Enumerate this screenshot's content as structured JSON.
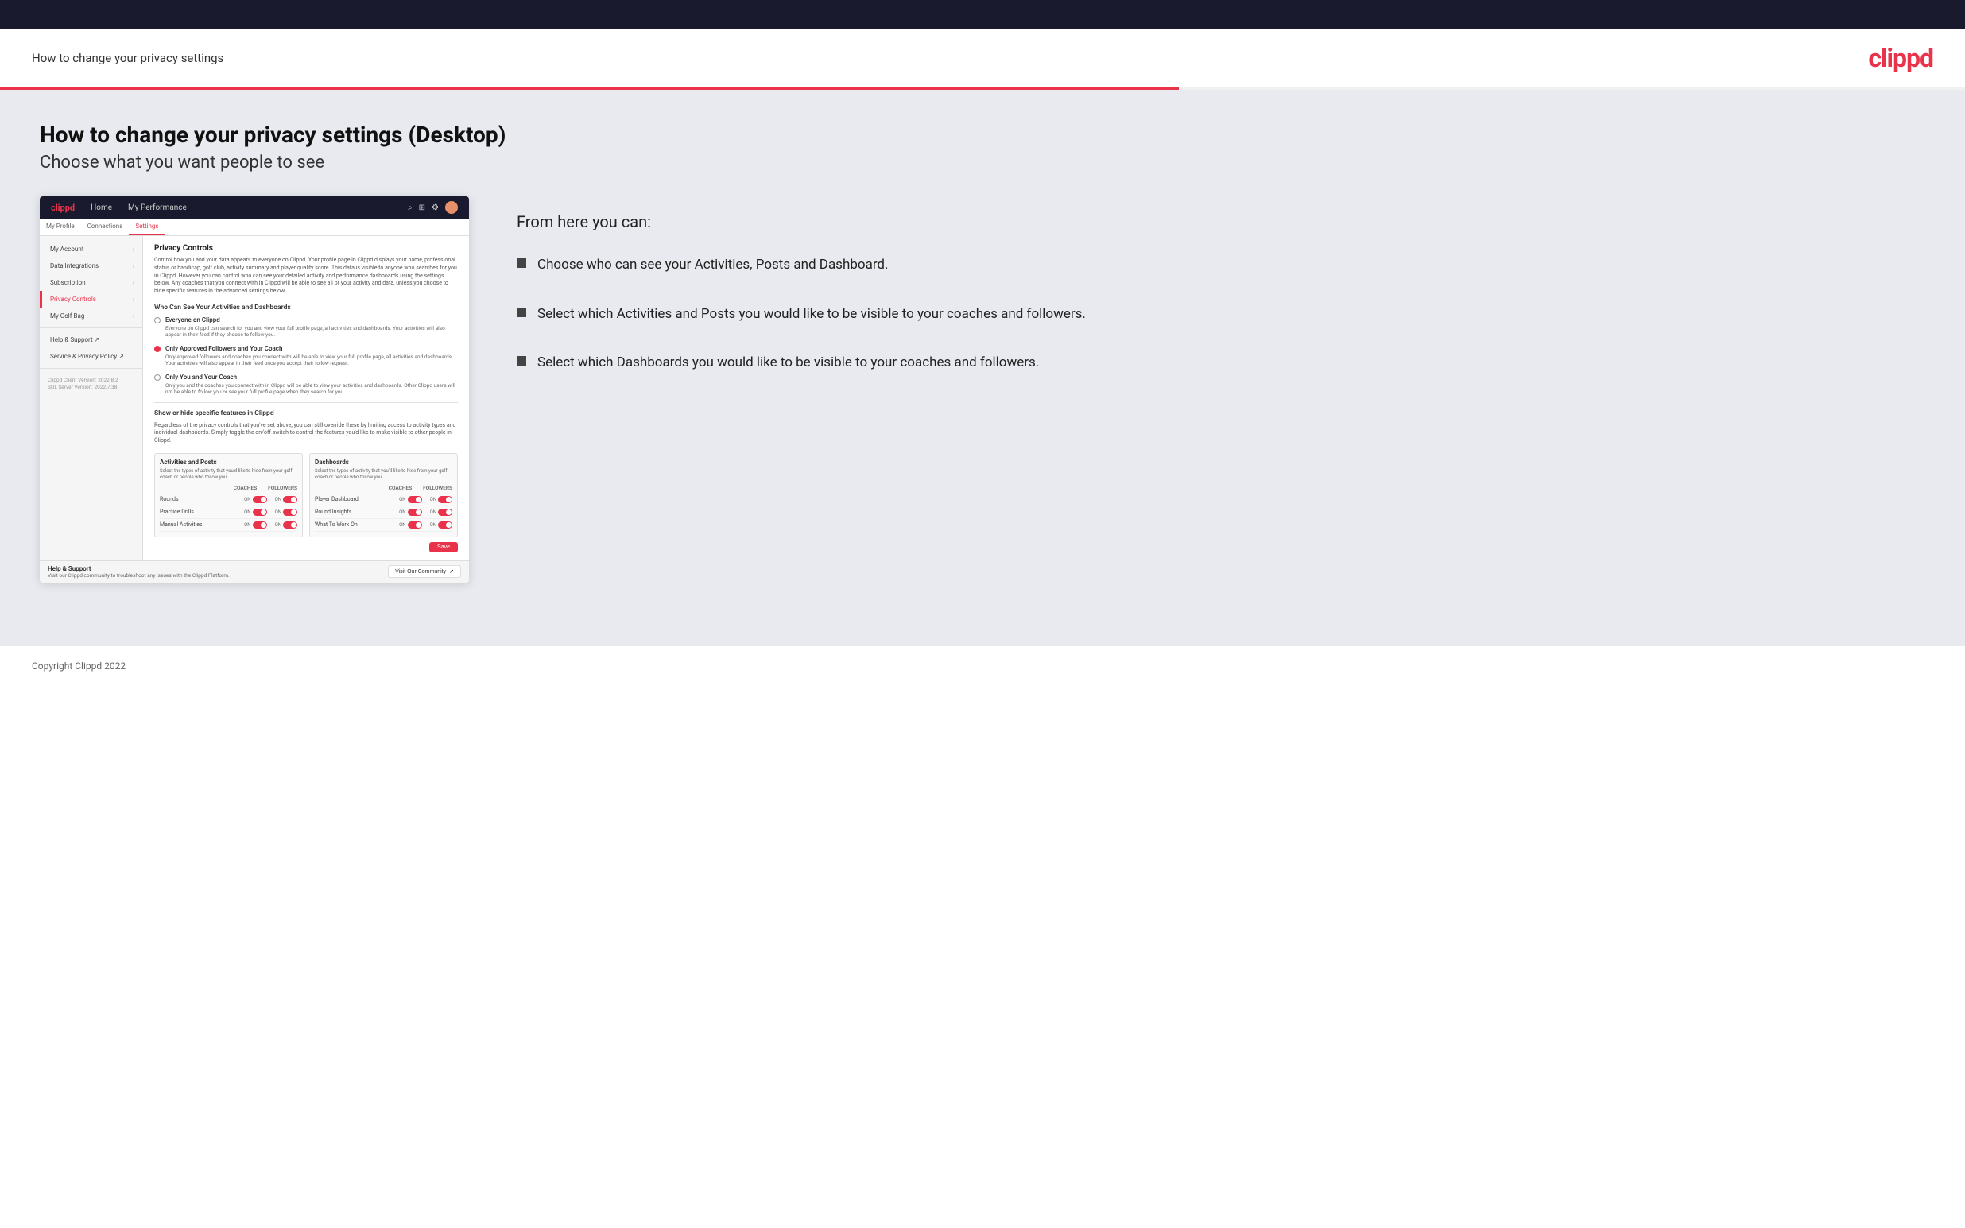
{
  "header": {
    "title": "How to change your privacy settings",
    "logo": "clippd"
  },
  "main": {
    "content_title": "How to change your privacy settings (Desktop)",
    "content_subtitle": "Choose what you want people to see",
    "info_from_title": "From here you can:",
    "bullets": [
      "Choose who can see your Activities, Posts and Dashboard.",
      "Select which Activities and Posts you would like to be visible to your coaches and followers.",
      "Select which Dashboards you would like to be visible to your coaches and followers."
    ]
  },
  "mock_app": {
    "navbar": {
      "logo": "clippd",
      "nav_items": [
        "Home",
        "My Performance"
      ]
    },
    "sidebar": {
      "tabs": [
        "My Profile",
        "Connections",
        "Settings"
      ],
      "active_tab": "Settings",
      "items": [
        {
          "label": "My Account",
          "active": false
        },
        {
          "label": "Data Integrations",
          "active": false
        },
        {
          "label": "Subscription",
          "active": false
        },
        {
          "label": "Privacy Controls",
          "active": true
        },
        {
          "label": "My Golf Bag",
          "active": false
        },
        {
          "label": "Help & Support",
          "active": false
        },
        {
          "label": "Service & Privacy Policy",
          "active": false
        }
      ],
      "version_text": "Clippd Client Version: 2022.8.2\nSQL Server Version: 2022.7.38"
    },
    "privacy_controls": {
      "section_title": "Privacy Controls",
      "section_desc": "Control how you and your data appears to everyone on Clippd. Your profile page in Clippd displays your name, professional status or handicap, golf club, activity summary and player quality score. This data is visible to anyone who searches for you in Clippd. However you can control who can see your detailed activity and performance dashboards using the settings below. Any coaches that you connect with in Clippd will be able to see all of your activity and data, unless you choose to hide specific features in the advanced settings below.",
      "who_can_see_title": "Who Can See Your Activities and Dashboards",
      "radio_options": [
        {
          "label": "Everyone on Clippd",
          "desc": "Everyone on Clippd can search for you and view your full profile page, all activities and dashboards. Your activities will also appear in their feed if they choose to follow you.",
          "selected": false
        },
        {
          "label": "Only Approved Followers and Your Coach",
          "desc": "Only approved followers and coaches you connect with will be able to view your full profile page, all activities and dashboards. Your activities will also appear in their feed once you accept their follow request.",
          "selected": true
        },
        {
          "label": "Only You and Your Coach",
          "desc": "Only you and the coaches you connect with in Clippd will be able to view your activities and dashboards. Other Clippd users will not be able to follow you or see your full profile page when they search for you.",
          "selected": false
        }
      ],
      "show_hide_title": "Show or hide specific features in Clippd",
      "show_hide_desc": "Regardless of the privacy controls that you've set above, you can still override these by limiting access to activity types and individual dashboards. Simply toggle the on/off switch to control the features you'd like to make visible to other people in Clippd.",
      "activities_posts": {
        "title": "Activities and Posts",
        "desc": "Select the types of activity that you'd like to hide from your golf coach or people who follow you.",
        "rows": [
          {
            "label": "Rounds",
            "coaches_on": true,
            "followers_on": true
          },
          {
            "label": "Practice Drills",
            "coaches_on": true,
            "followers_on": true
          },
          {
            "label": "Manual Activities",
            "coaches_on": true,
            "followers_on": true
          }
        ]
      },
      "dashboards": {
        "title": "Dashboards",
        "desc": "Select the types of activity that you'd like to hide from your golf coach or people who follow you.",
        "rows": [
          {
            "label": "Player Dashboard",
            "coaches_on": true,
            "followers_on": true
          },
          {
            "label": "Round Insights",
            "coaches_on": true,
            "followers_on": true
          },
          {
            "label": "What To Work On",
            "coaches_on": true,
            "followers_on": true
          }
        ]
      }
    },
    "help": {
      "title": "Help & Support",
      "desc": "Visit our Clippd community to troubleshoot any issues with the Clippd Platform.",
      "button_label": "Visit Our Community"
    }
  },
  "footer": {
    "text": "Copyright Clippd 2022"
  }
}
